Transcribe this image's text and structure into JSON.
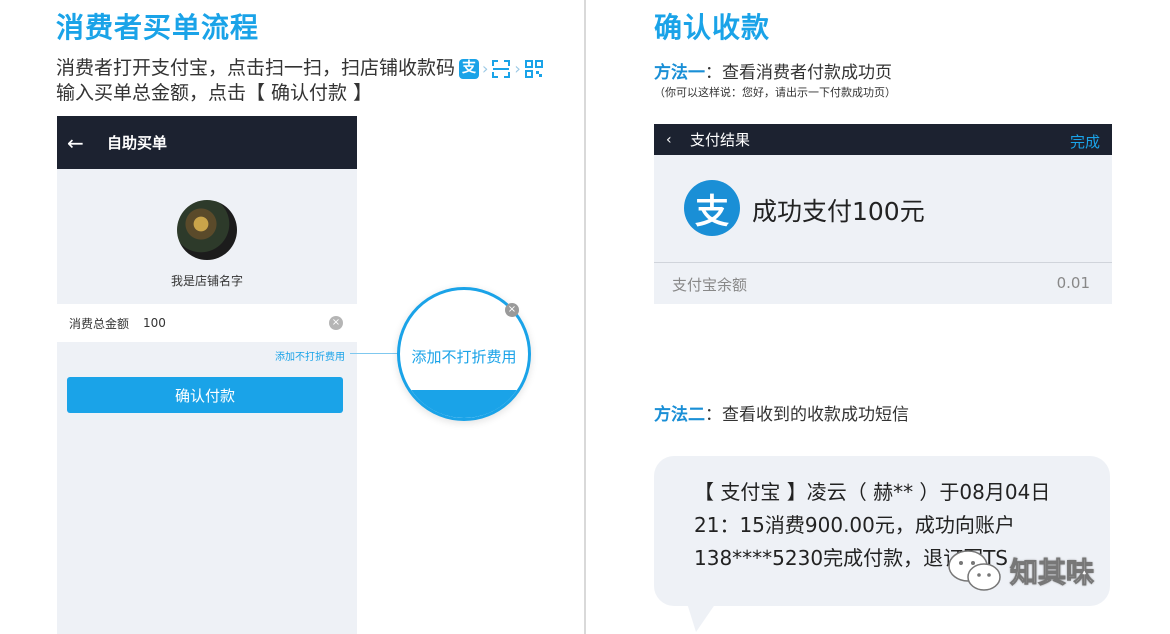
{
  "left": {
    "title": "消费者买单流程",
    "instruction_line1": "消费者打开支付宝，点击扫一扫，扫店铺收款码",
    "instruction_line2": "输入买单总金额，点击【 确认付款 】",
    "icons": [
      "alipay-icon",
      "chevron-right-icon",
      "scan-icon",
      "chevron-right-icon",
      "qr-code-icon"
    ],
    "alipay_glyph": "支",
    "chevron": "›",
    "phone": {
      "back": "←",
      "title": "自助买单",
      "shop_name": "我是店铺名字",
      "amount_label": "消费总金额",
      "amount_value": "100",
      "clear": "×",
      "add_fee": "添加不打折费用",
      "confirm_button": "确认付款"
    },
    "magnified_text": "添加不打折费用"
  },
  "right": {
    "title": "确认收款",
    "method1_label": "方法一",
    "method1_text": "：查看消费者付款成功页",
    "method1_note": "（你可以这样说：您好，请出示一下付款成功页）",
    "phone": {
      "back": "‹",
      "title": "支付结果",
      "done": "完成",
      "alipay_glyph": "支",
      "success": "成功支付100元",
      "balance_label": "支付宝余额",
      "balance_value": "0.01"
    },
    "method2_label": "方法二",
    "method2_text": "：查看收到的收款成功短信",
    "sms_text": "【 支付宝 】凌云（ 赫** ）于08月04日21：15消费900.00元，成功向账户138****5230完成付款，退订回TS"
  },
  "watermark": "知其味",
  "colors": {
    "accent": "#1aa3e8",
    "dark_bar": "#1c2230",
    "panel": "#eef1f6"
  }
}
